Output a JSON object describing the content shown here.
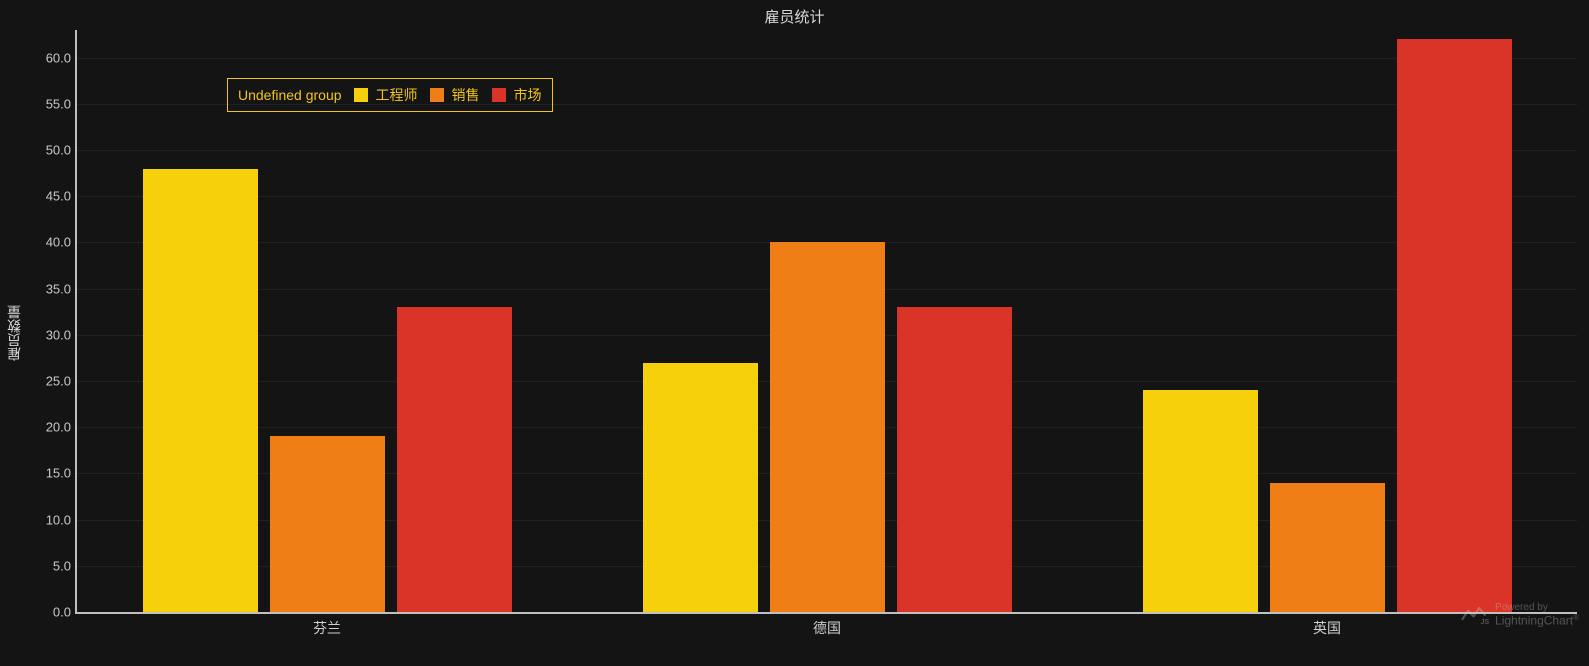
{
  "chart_data": {
    "type": "bar",
    "title": "雇员统计",
    "ylabel": "雇员数量",
    "xlabel": "",
    "ylim": [
      0,
      63
    ],
    "yticks": [
      0.0,
      5.0,
      10.0,
      15.0,
      20.0,
      25.0,
      30.0,
      35.0,
      40.0,
      45.0,
      50.0,
      55.0,
      60.0
    ],
    "categories": [
      "芬兰",
      "德国",
      "英国"
    ],
    "series": [
      {
        "name": "工程师",
        "color": "#f6d10b",
        "values": [
          48,
          27,
          24
        ]
      },
      {
        "name": "销售",
        "color": "#ee7e15",
        "values": [
          19,
          40,
          14
        ]
      },
      {
        "name": "市场",
        "color": "#d93427",
        "values": [
          33,
          33,
          62
        ]
      }
    ],
    "legend_title": "Undefined group",
    "legend_border_color": "#f0c419"
  },
  "watermark": {
    "line1": "Powered by",
    "line2": "LightningChart",
    "reg": "®"
  }
}
